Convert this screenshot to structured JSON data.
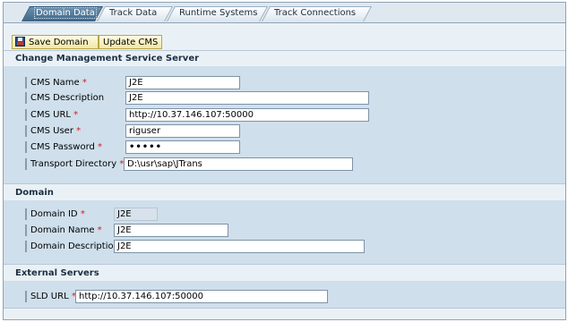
{
  "tabs": [
    {
      "label": "Domain Data",
      "active": true
    },
    {
      "label": "Track Data",
      "active": false
    },
    {
      "label": "Runtime Systems",
      "active": false
    },
    {
      "label": "Track Connections",
      "active": false
    }
  ],
  "toolbar": {
    "save_label": "Save Domain",
    "save_icon": "floppy-disk-icon",
    "update_label": "Update CMS"
  },
  "sections": {
    "cms_title": "Change Management Service Server",
    "domain_title": "Domain",
    "external_title": "External Servers"
  },
  "cms": {
    "name": {
      "label": "CMS Name",
      "required": "*",
      "value": "J2E"
    },
    "description": {
      "label": "CMS Description",
      "value": "J2E"
    },
    "url": {
      "label": "CMS URL",
      "required": "*",
      "value": "http://10.37.146.107:50000"
    },
    "user": {
      "label": "CMS User",
      "required": "*",
      "value": "riguser"
    },
    "password": {
      "label": "CMS Password",
      "required": "*",
      "value": "•••••"
    },
    "transport_dir": {
      "label": "Transport Directory",
      "required": "*",
      "value": "D:\\usr\\sap\\JTrans"
    }
  },
  "domain": {
    "id": {
      "label": "Domain ID",
      "required": "*",
      "value": "J2E"
    },
    "name": {
      "label": "Domain Name",
      "required": "*",
      "value": "J2E"
    },
    "description": {
      "label": "Domain Description",
      "value": "J2E"
    }
  },
  "external": {
    "sld_url": {
      "label": "SLD URL",
      "required": "*",
      "value": "http://10.37.146.107:50000"
    }
  },
  "colors": {
    "accent": "#3d6688",
    "required": "#d21a1a",
    "panel": "#cfdfec"
  }
}
